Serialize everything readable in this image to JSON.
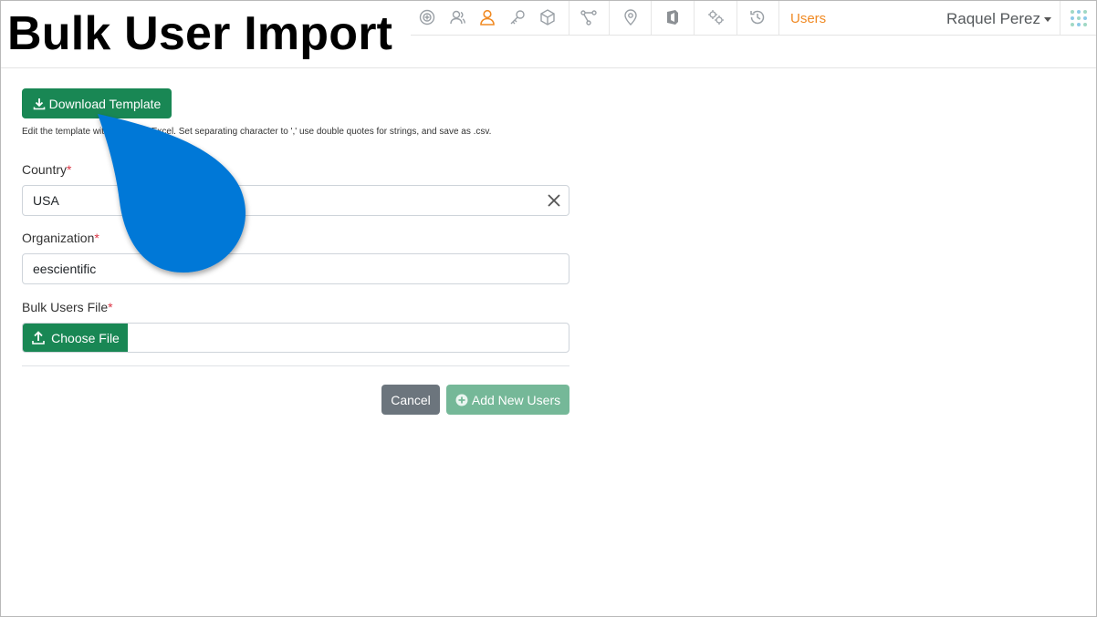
{
  "title": "Bulk User Import",
  "nav": {
    "icons": [
      "settings-badge-icon",
      "user-group-icon",
      "user-icon",
      "key-icon",
      "cube-icon",
      "workflow-icon",
      "location-pin-icon",
      "shield-icon",
      "gears-icon",
      "history-icon"
    ],
    "active_label": "Users",
    "user_name": "Raquel Perez"
  },
  "download_button": {
    "label": "Download Template"
  },
  "help_text": "Edit the template with Microsoft Excel. Set separating character to ',' use double quotes for strings, and save as .csv.",
  "fields": {
    "country": {
      "label": "Country",
      "required_mark": "*",
      "value": "USA"
    },
    "organization": {
      "label": "Organization",
      "required_mark": "*",
      "value": "eescientific"
    },
    "bulk_file": {
      "label": "Bulk Users File",
      "required_mark": "*",
      "button_label": "Choose File",
      "file_name": ""
    }
  },
  "actions": {
    "cancel": "Cancel",
    "add": "Add New Users"
  },
  "colors": {
    "primary_green": "#198754",
    "disabled_green": "#75b898",
    "secondary_gray": "#6c757d",
    "accent_orange": "#f08a24",
    "required_red": "#dc3545",
    "pointer_blue": "#0078d7"
  }
}
